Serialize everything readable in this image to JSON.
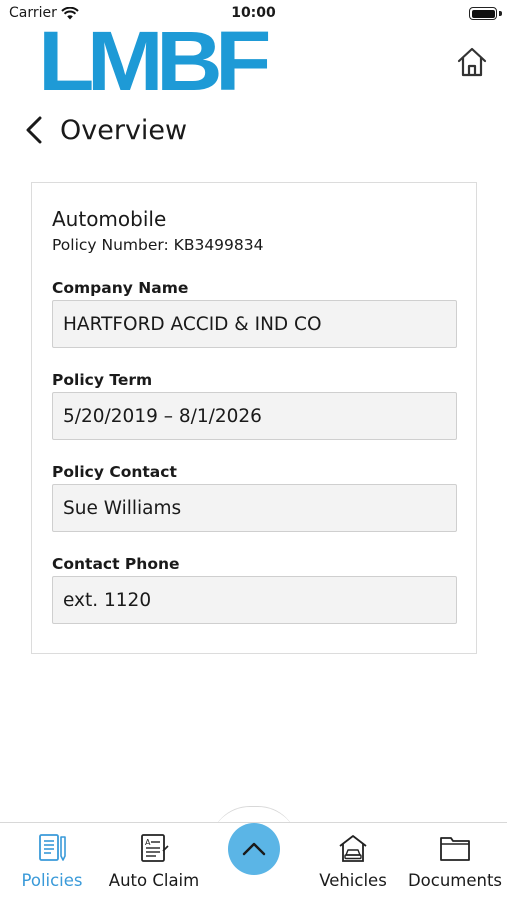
{
  "status_bar": {
    "carrier": "Carrier",
    "time": "10:00"
  },
  "logo": {
    "text": "LMBF"
  },
  "header": {
    "title": "Overview"
  },
  "policy": {
    "type": "Automobile",
    "number": "Policy Number: KB3499834",
    "fields": [
      {
        "label": "Company Name",
        "value": "HARTFORD ACCID & IND CO"
      },
      {
        "label": "Policy Term",
        "value": "5/20/2019 – 8/1/2026"
      },
      {
        "label": "Policy Contact",
        "value": "Sue Williams"
      },
      {
        "label": "Contact Phone",
        "value": "ext. 1120"
      }
    ]
  },
  "tabs": [
    {
      "label": "Policies",
      "icon": "policies-icon",
      "active": true
    },
    {
      "label": "Auto Claim",
      "icon": "auto-claim-icon",
      "active": false
    },
    {
      "label": "Vehicles",
      "icon": "vehicles-icon",
      "active": false
    },
    {
      "label": "Documents",
      "icon": "documents-icon",
      "active": false
    }
  ],
  "center_button": {
    "icon": "chevron-up-icon"
  },
  "colors": {
    "brand": "#1e9ad6",
    "active_tab": "#3a9ad9",
    "center_button": "#5bb5e6",
    "text": "#1a1a1a"
  }
}
